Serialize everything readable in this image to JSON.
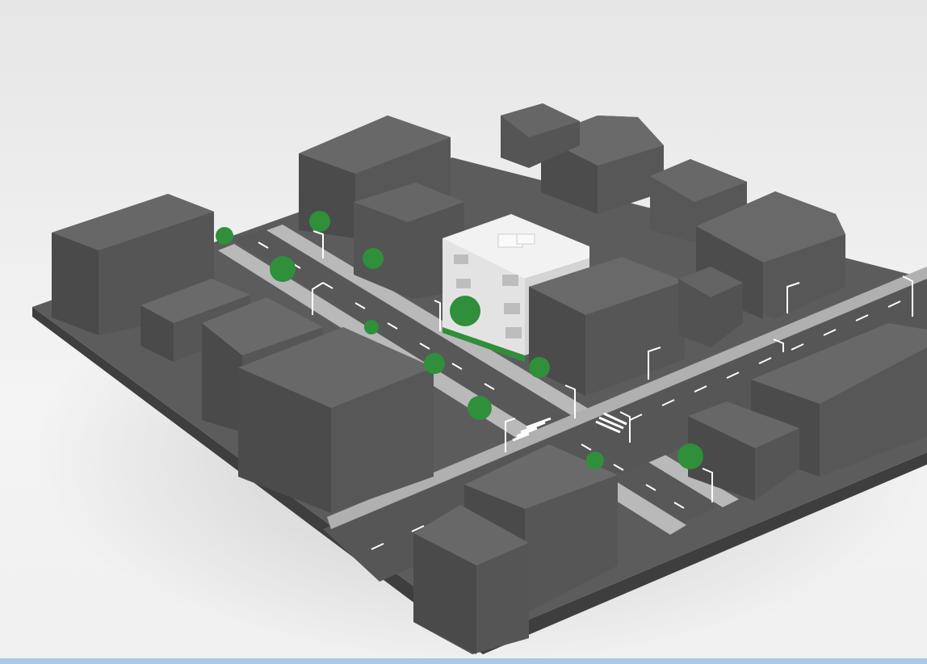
{
  "viewport": {
    "label": "",
    "background": "#f0f0f0"
  },
  "colors": {
    "building_top": "#616161",
    "building_left": "#4f4f4f",
    "building_right": "#575757",
    "ground": "#5e5e5e",
    "ground_side": "#3f3f3f",
    "road": "#555555",
    "sidewalk": "#bdbdbd",
    "focus_building": "#e9e9e9",
    "tree": "#2f8f3b",
    "lane_marking": "#ffffff",
    "status_bar": "#a9c9e4"
  },
  "scene": {
    "focus_building": "white-highlighted-building",
    "icons": [
      "tree-icon",
      "street-lamp-icon",
      "crosswalk-icon"
    ]
  }
}
